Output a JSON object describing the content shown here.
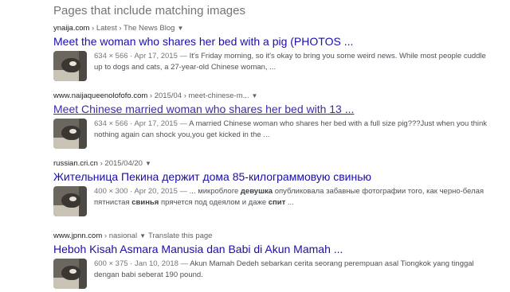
{
  "section_title": "Pages that include matching images",
  "results": [
    {
      "domain": "ynaija.com",
      "path": " › Latest › The News Blog",
      "title": "Meet the woman who shares her bed with a pig (PHOTOS ...",
      "dims": "634 × 566",
      "date": "Apr 17, 2015",
      "snippet": "It's Friday morning, so it's okay to bring you some weird news. While most people cuddle up to dogs and cats, a 27-year-old Chinese woman, ..."
    },
    {
      "domain": "www.naijaqueenolofofo.com",
      "path": " › 2015/04 › meet-chinese-m...",
      "title": "Meet Chinese married woman who shares her bed with 13 ...",
      "dims": "634 × 566",
      "date": "Apr 17, 2015",
      "snippet": "A married Chinese woman who shares her bed with a full size pig???Just when you think nothing again can shock you,you get kicked in the ..."
    },
    {
      "domain": "russian.cri.cn",
      "path": " › 2015/04/20",
      "title": "Жительница Пекина держит дома 85-килограммовую свинью",
      "dims": "400 × 300",
      "date": "Apr 20, 2015",
      "snippet_parts": [
        "... микроблоге ",
        "девушка",
        " опубликовала забавные фотографии того, как черно-белая пятнистая ",
        "свинья",
        " прячется под одеялом и даже ",
        "спит",
        " ..."
      ]
    },
    {
      "domain": "www.jpnn.com",
      "path": " › nasional",
      "translate": "Translate this page",
      "title": "Heboh Kisah Asmara Manusia dan Babi di Akun Mamah ...",
      "dims": "600 × 375",
      "date": "Jan 10, 2018",
      "snippet": "Akun Mamah Dedeh sebarkan cerita seorang perempuan asal Tiongkok yang tinggal dengan babi seberat 190 pound."
    }
  ],
  "icons": {
    "thumbnail": "pig-photo-thumbnail",
    "menu": "caret-down-icon"
  }
}
